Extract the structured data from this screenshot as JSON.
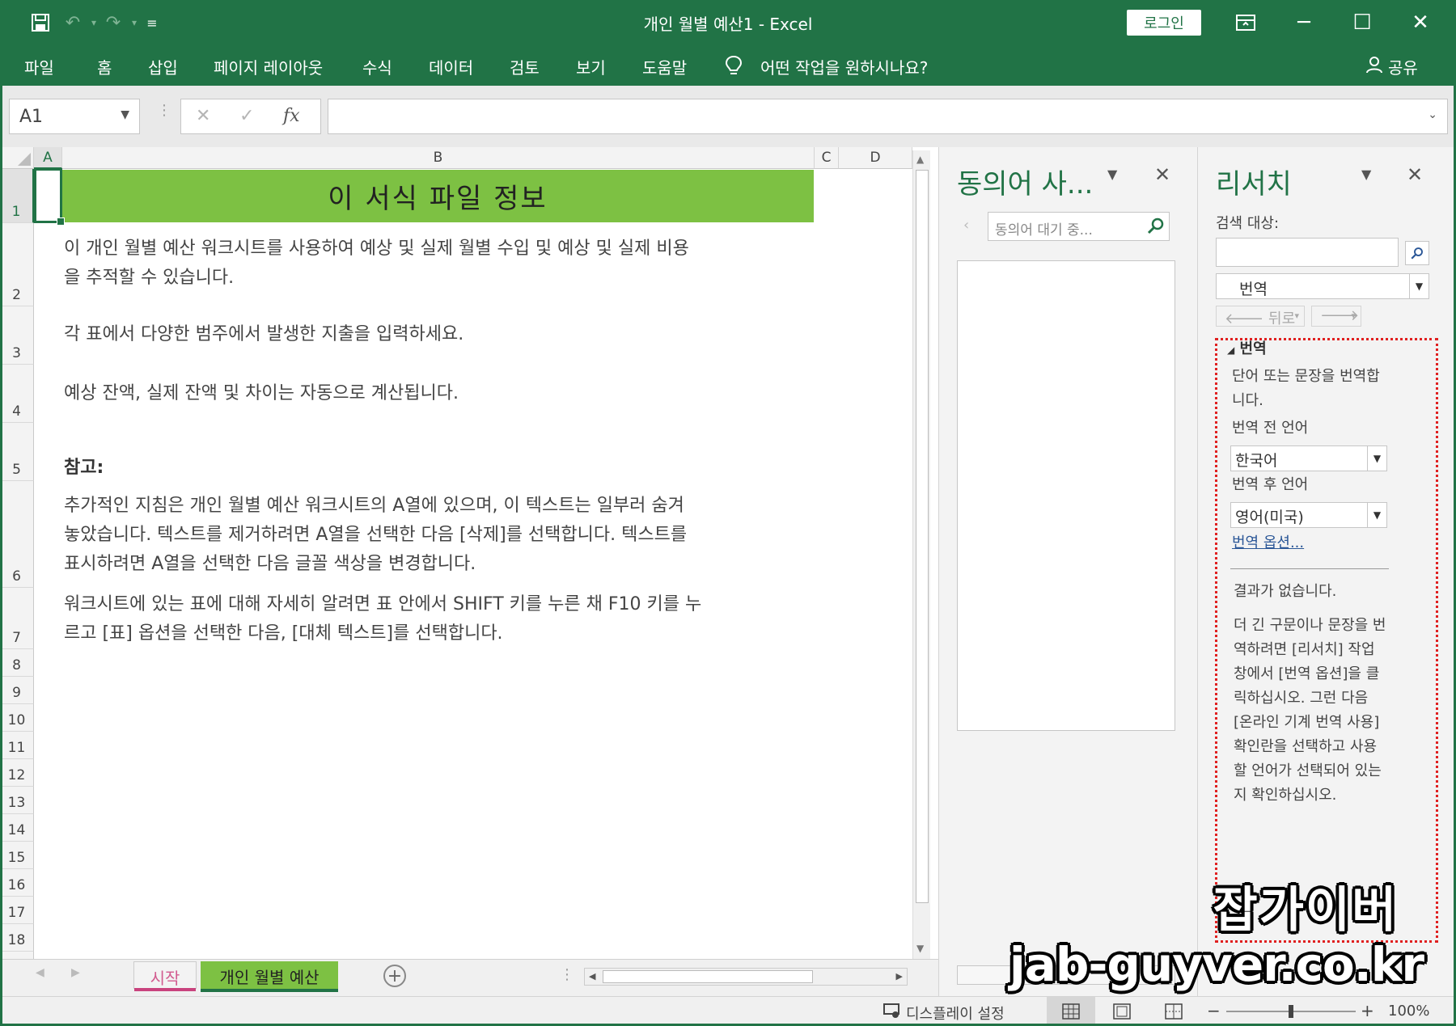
{
  "window": {
    "title": "개인 월별 예산1  -  Excel",
    "login_label": "로그인",
    "minimize": "─",
    "maximize": "☐",
    "close": "✕"
  },
  "menu": {
    "items": [
      "파일",
      "홈",
      "삽입",
      "페이지 레이아웃",
      "수식",
      "데이터",
      "검토",
      "보기",
      "도움말"
    ],
    "tell_me": "어떤 작업을 원하시나요?",
    "share": "공유"
  },
  "formula_bar": {
    "name_box": "A1",
    "value": ""
  },
  "grid": {
    "columns": [
      "A",
      "B",
      "C",
      "D"
    ],
    "rows": [
      "1",
      "2",
      "3",
      "4",
      "5",
      "6",
      "7",
      "8",
      "9",
      "10",
      "11",
      "12",
      "13",
      "14",
      "15",
      "16",
      "17",
      "18"
    ],
    "title": "이 서식 파일 정보",
    "paragraphs": [
      "이 개인 월별 예산 워크시트를 사용하여 예상 및 실제 월별 수입 및 예상 및 실제 비용",
      "을 추적할 수 있습니다.",
      "각 표에서 다양한 범주에서 발생한 지출을 입력하세요.",
      "예상 잔액, 실제 잔액 및 차이는 자동으로 계산됩니다.",
      "참고:",
      "추가적인 지침은 개인 월별 예산 워크시트의 A열에 있으며, 이 텍스트는 일부러 숨겨",
      "놓았습니다. 텍스트를 제거하려면 A열을 선택한 다음 [삭제]를 선택합니다. 텍스트를",
      "표시하려면 A열을 선택한 다음 글꼴 색상을 변경합니다.",
      "워크시트에 있는 표에 대해 자세히 알려면 표 안에서 SHIFT 키를 누른 채 F10 키를 누",
      "르고 [표] 옵션을 선택한 다음, [대체 텍스트]를 선택합니다."
    ]
  },
  "sheets": {
    "tabs": [
      "시작",
      "개인 월별 예산"
    ],
    "active": "개인 월별 예산"
  },
  "status": {
    "display_settings": "디스플레이 설정",
    "zoom_minus": "−",
    "zoom_plus": "+",
    "zoom": "100%",
    "zoom_fraction": 0.5
  },
  "synonym_pane": {
    "title": "동의어 사...",
    "search_placeholder": "동의어 대기 중..."
  },
  "research_pane": {
    "title": "리서치",
    "search_for": "검색 대상:",
    "source": "번역",
    "back": "뒤로",
    "section_title": "번역",
    "section_desc": [
      "단어 또는 문장을 번역합",
      "니다."
    ],
    "from_label": "번역 전 언어",
    "from_value": "한국어",
    "to_label": "번역 후 언어",
    "to_value": "영어(미국)",
    "options_link": "번역 옵션...",
    "no_results": "결과가 없습니다.",
    "help": [
      "더 긴 구문이나 문장을 번",
      "역하려면 [리서치] 작업",
      "창에서 [번역 옵션]을 클",
      "릭하십시오. 그런 다음",
      "[온라인 기계 번역 사용]",
      "확인란을 선택하고 사용",
      "할 언어가 선택되어 있는",
      "지 확인하십시오."
    ]
  },
  "watermark": {
    "line1": "잡가이버",
    "line2": "jab-guyver.co.kr"
  },
  "colors": {
    "excel_green": "#217346",
    "banner_green": "#7dc143",
    "link_blue": "#2b5797"
  }
}
